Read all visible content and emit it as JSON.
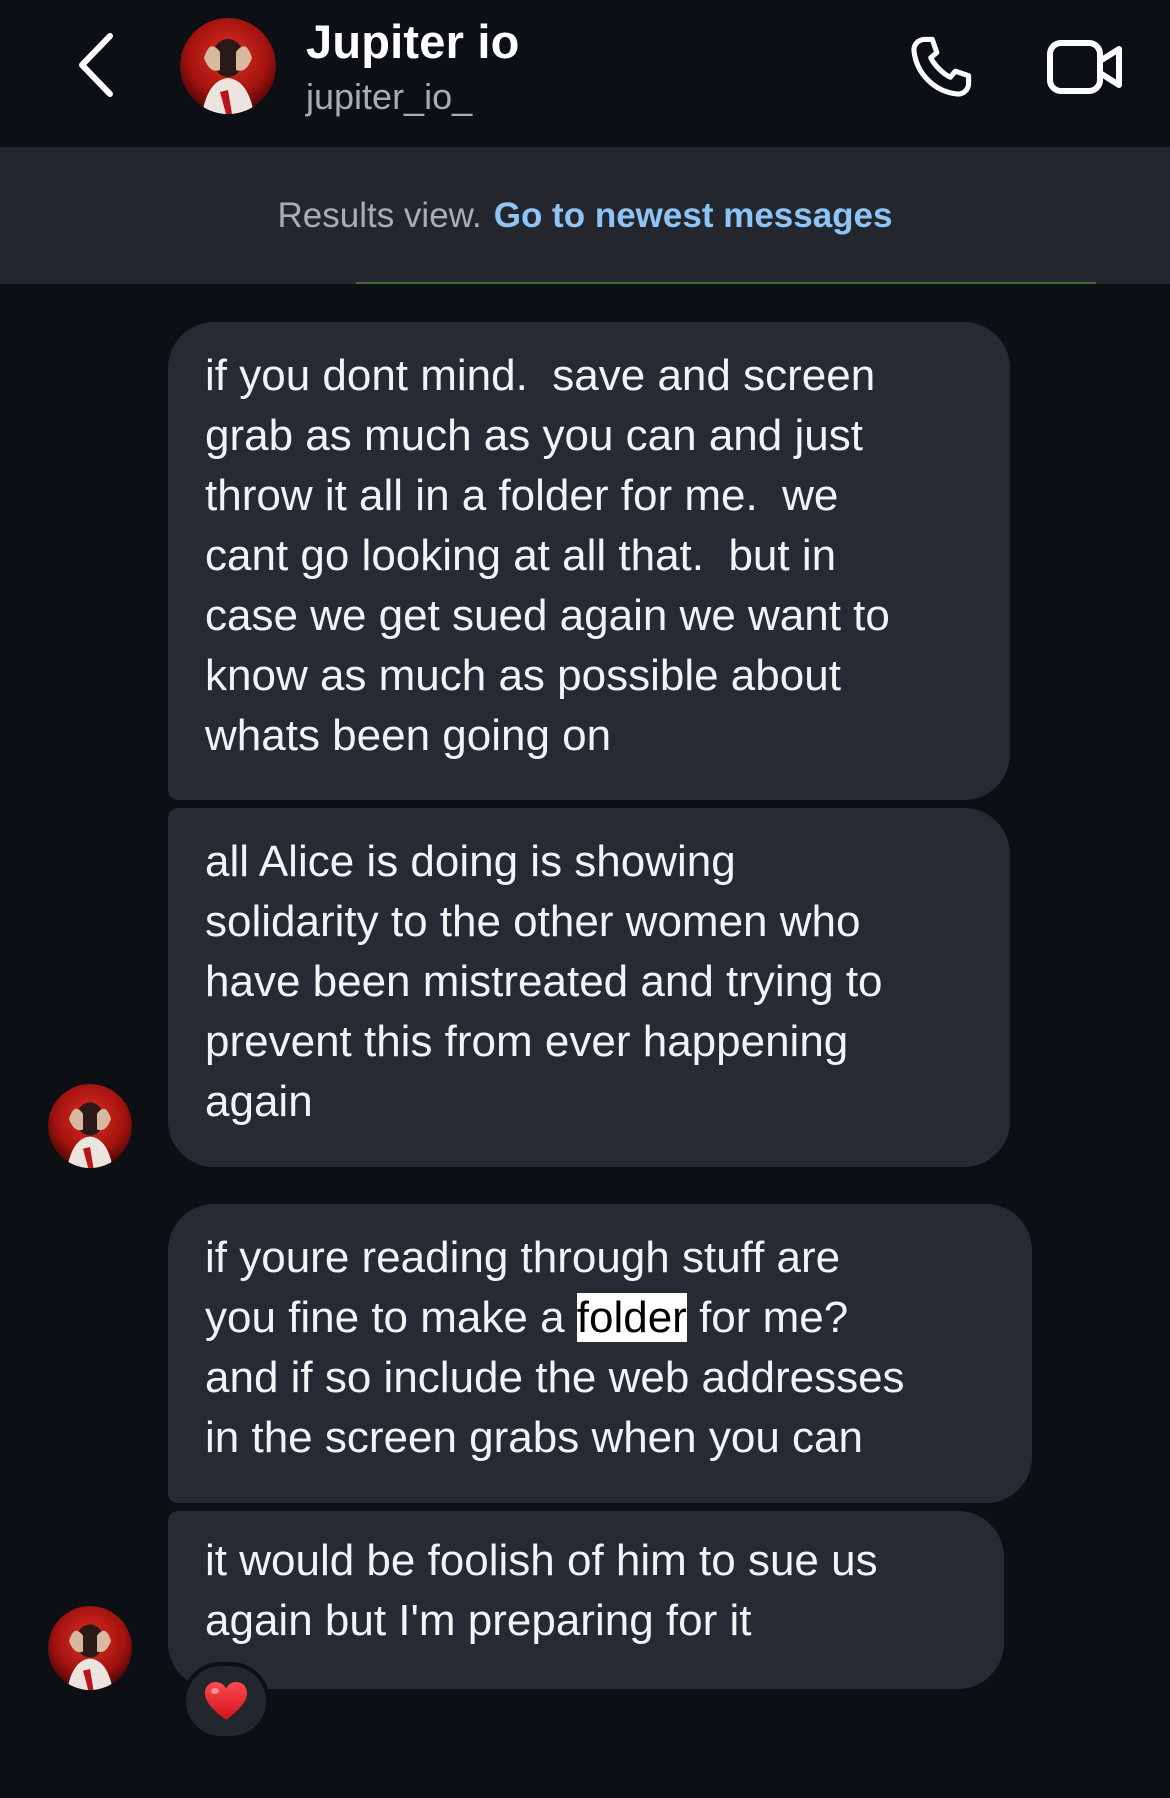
{
  "header": {
    "name": "Jupiter io",
    "handle": "jupiter_io_",
    "icons": {
      "back": "chevron-left-icon",
      "call": "phone-icon",
      "video": "video-camera-icon",
      "avatar": "profile-avatar"
    }
  },
  "banner": {
    "prefix": "Results view.",
    "link": "Go to newest messages"
  },
  "messages": [
    {
      "text": "if you dont mind.  save and screen\ngrab as much as you can and just\nthrow it all in a folder for me.  we\ncant go looking at all that.  but in\ncase we get sued again we want to\nknow as much as possible about\nwhats been going on"
    },
    {
      "text": "all Alice is doing is showing\nsolidarity to the other women who\nhave been mistreated and trying to\nprevent this from ever happening\nagain"
    },
    {
      "before": "if youre reading through stuff are\nyou fine to make a ",
      "highlight": "folder",
      "after": " for me?\nand if so include the web addresses\nin the screen grabs when you can"
    },
    {
      "text": "it would be foolish of him to sue us\nagain but I'm preparing for it",
      "reaction": "red-heart-icon"
    }
  ],
  "colors": {
    "background": "#0c0f14",
    "bubble": "#262a32",
    "banner": "#23262d",
    "link": "#8ec5f6",
    "heart": "#e8202a"
  }
}
